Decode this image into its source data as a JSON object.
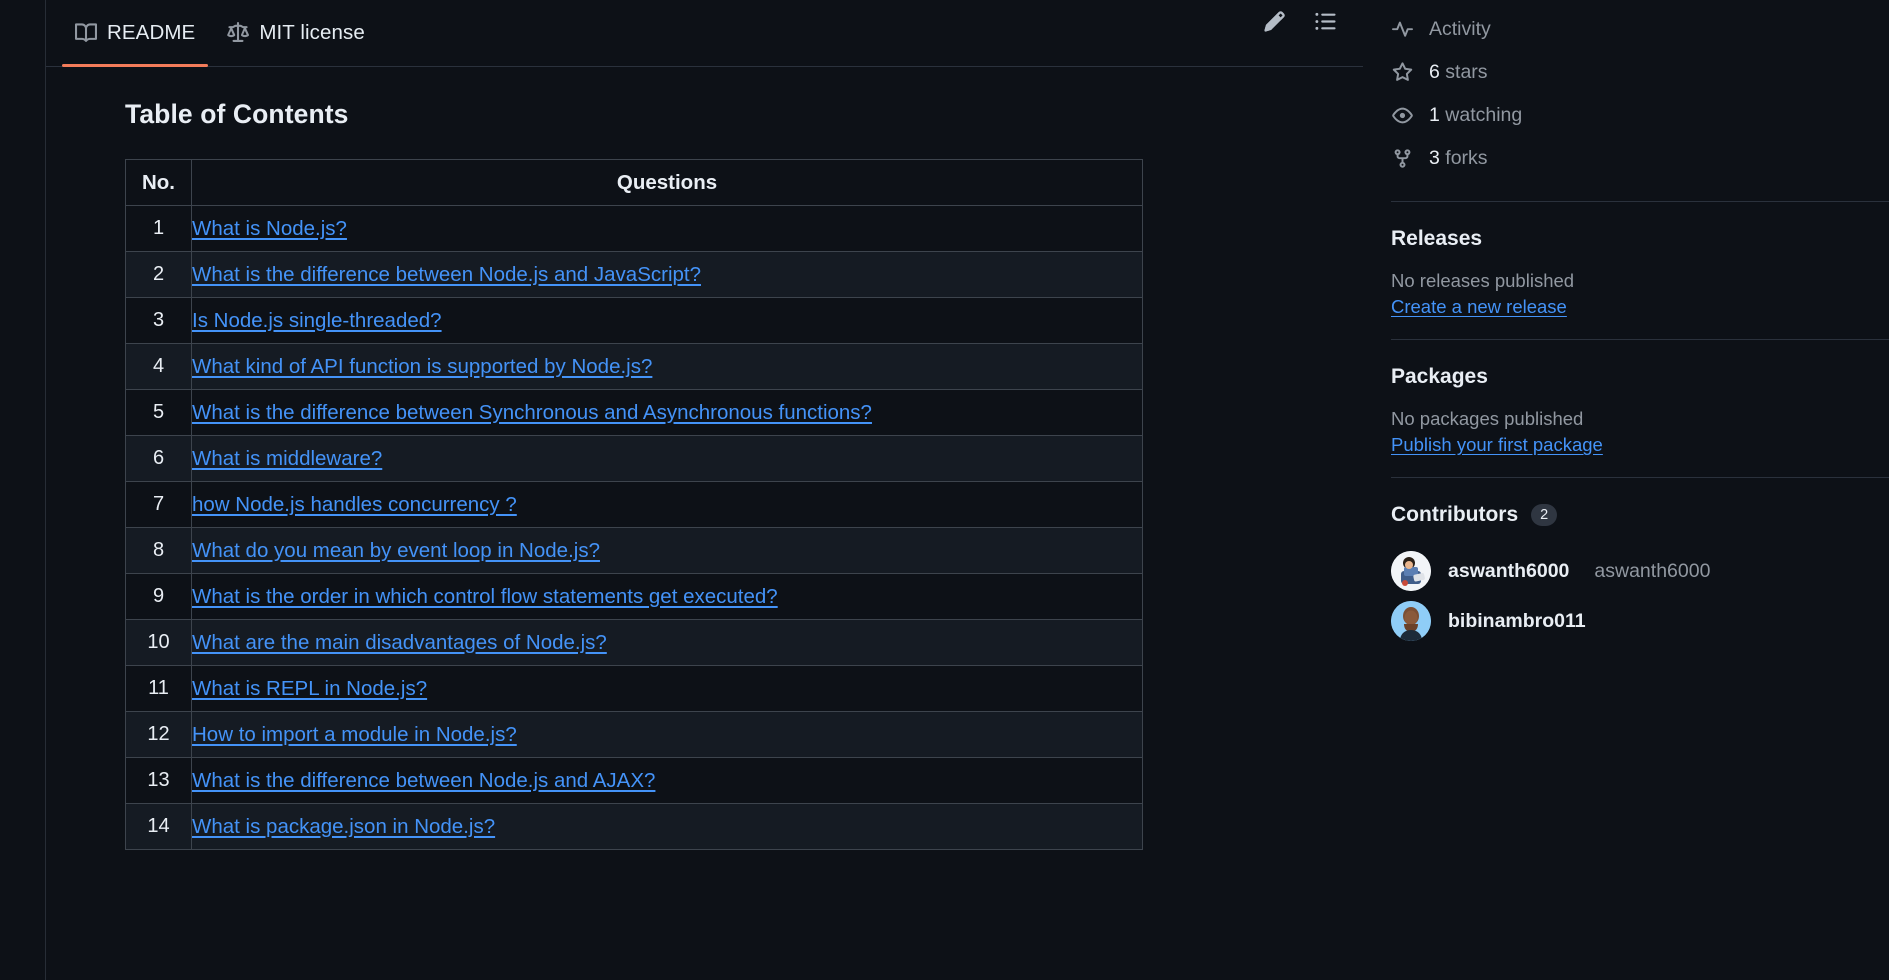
{
  "tabs": [
    {
      "label": "README",
      "icon": "book-icon",
      "active": true
    },
    {
      "label": "MIT license",
      "icon": "scale-icon",
      "active": false
    }
  ],
  "tab_actions": [
    {
      "name": "edit-pencil-icon",
      "label": "Edit"
    },
    {
      "name": "outline-list-icon",
      "label": "Outline"
    }
  ],
  "readme": {
    "title": "Table of Contents",
    "columns": {
      "no": "No.",
      "questions": "Questions"
    },
    "rows": [
      {
        "no": "1",
        "question": "What is Node.js?"
      },
      {
        "no": "2",
        "question": "What is the difference between Node.js and JavaScript?"
      },
      {
        "no": "3",
        "question": "Is Node.js single-threaded?"
      },
      {
        "no": "4",
        "question": "What kind of API function is supported by Node.js?"
      },
      {
        "no": "5",
        "question": "What is the difference between Synchronous and Asynchronous functions?"
      },
      {
        "no": "6",
        "question": "What is middleware?"
      },
      {
        "no": "7",
        "question": "how Node.js handles concurrency ?"
      },
      {
        "no": "8",
        "question": "What do you mean by event loop in Node.js?"
      },
      {
        "no": "9",
        "question": "What is the order in which control flow statements get executed?"
      },
      {
        "no": "10",
        "question": "What are the main disadvantages of Node.js?"
      },
      {
        "no": "11",
        "question": "What is REPL in Node.js?"
      },
      {
        "no": "12",
        "question": "How to import a module in Node.js?"
      },
      {
        "no": "13",
        "question": "What is the difference between Node.js and AJAX?"
      },
      {
        "no": "14",
        "question": "What is package.json in Node.js?"
      }
    ]
  },
  "sidebar": {
    "stats": [
      {
        "icon": "pulse-icon",
        "text": "Activity",
        "value": "",
        "label": "Activity"
      },
      {
        "icon": "star-icon",
        "value": "6",
        "label": "stars"
      },
      {
        "icon": "eye-icon",
        "value": "1",
        "label": "watching"
      },
      {
        "icon": "fork-icon",
        "value": "3",
        "label": "forks"
      }
    ],
    "releases": {
      "heading": "Releases",
      "empty_text": "No releases published",
      "link_text": "Create a new release"
    },
    "packages": {
      "heading": "Packages",
      "empty_text": "No packages published",
      "link_text": "Publish your first package"
    },
    "contributors": {
      "heading": "Contributors",
      "count": "2",
      "people": [
        {
          "name": "aswanth6000",
          "handle": "aswanth6000"
        },
        {
          "name": "bibinambro011",
          "handle": ""
        }
      ]
    }
  },
  "colors": {
    "background": "#0d1117",
    "link": "#4493f8",
    "accent": "#f27c5a",
    "muted": "#9198a1",
    "border": "#3d444d"
  }
}
